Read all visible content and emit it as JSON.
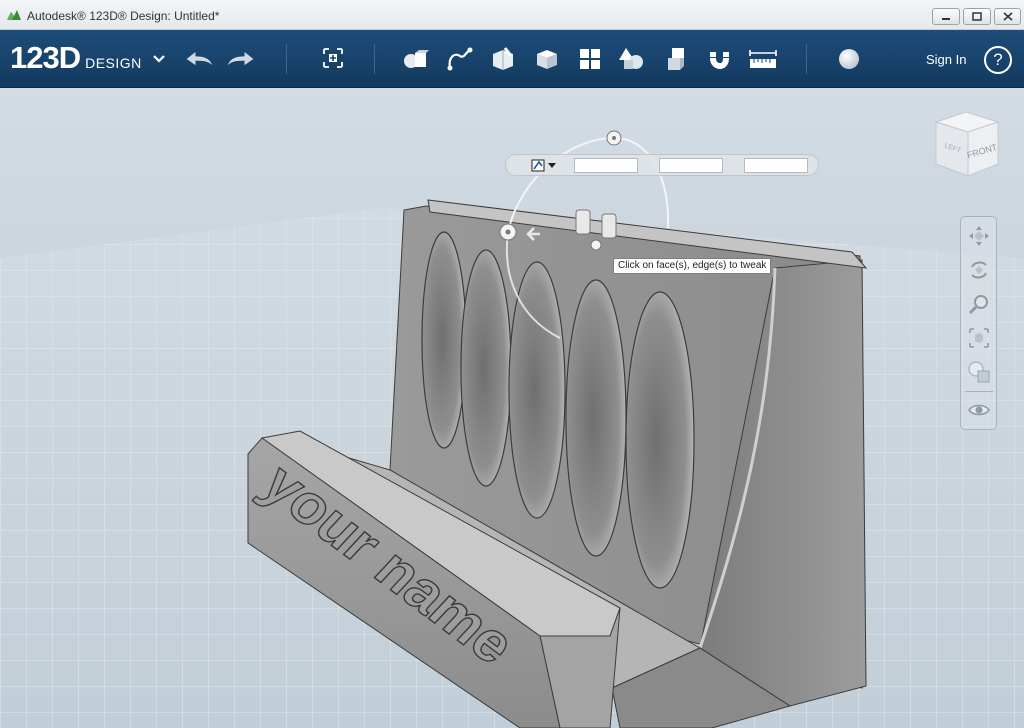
{
  "window": {
    "title": "Autodesk® 123D® Design: Untitled*"
  },
  "toolbar": {
    "logo_number": "123D",
    "logo_word": "DESIGN",
    "sign_in_label": "Sign In",
    "help_label": "?",
    "icons": [
      "undo-icon",
      "redo-icon",
      "transform-icon",
      "primitives-icon",
      "sketch-icon",
      "construct-icon",
      "modify-icon",
      "pattern-icon",
      "grouping-icon",
      "combine-icon",
      "snap-icon",
      "measure-icon",
      "material-icon"
    ]
  },
  "tweak_bar": {
    "field_1": "",
    "field_2": "",
    "field_3": ""
  },
  "tooltip": {
    "text": "Click on face(s), edge(s) to tweak"
  },
  "viewcube": {
    "face_label": "FRONT",
    "side_label": "LEFT"
  },
  "model": {
    "engraved_text": "your name"
  },
  "colors": {
    "toolbar_bg": "#17426b",
    "viewport_bg": "#c8d2db",
    "model_gray": "#8c8c8c"
  }
}
